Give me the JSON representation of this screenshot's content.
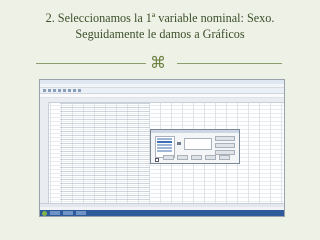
{
  "slide": {
    "title_line1": "2. Seleccionamos la 1ª variable nominal: Sexo.",
    "title_line2": "Seguidamente le damos a Gráficos",
    "ornament_glyph": "⌘",
    "accent_color": "#3c4f2a",
    "rule_color": "#8d9e6e"
  },
  "screenshot": {
    "app": "SPSS Data Editor",
    "dialog": "Frecuencias"
  }
}
